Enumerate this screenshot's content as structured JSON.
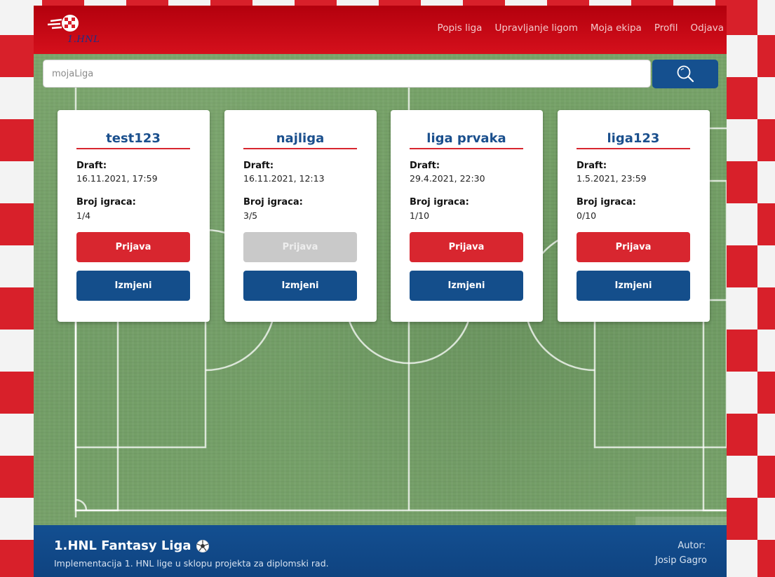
{
  "brand": {
    "logo_text": "1.HNL"
  },
  "nav": {
    "links": [
      "Popis liga",
      "Upravljanje ligom",
      "Moja ekipa",
      "Profil",
      "Odjava"
    ]
  },
  "search": {
    "placeholder": "mojaLiga",
    "value": ""
  },
  "leagues": [
    {
      "name": "test123",
      "draft_label": "Draft:",
      "draft": "16.11.2021, 17:59",
      "players_label": "Broj igraca:",
      "players": "1/4",
      "join_label": "Prijava",
      "join_enabled": true,
      "edit_label": "Izmjeni"
    },
    {
      "name": "najliga",
      "draft_label": "Draft:",
      "draft": "16.11.2021, 12:13",
      "players_label": "Broj igraca:",
      "players": "3/5",
      "join_label": "Prijava",
      "join_enabled": false,
      "edit_label": "Izmjeni"
    },
    {
      "name": "liga prvaka",
      "draft_label": "Draft:",
      "draft": "29.4.2021, 22:30",
      "players_label": "Broj igraca:",
      "players": "1/10",
      "join_label": "Prijava",
      "join_enabled": true,
      "edit_label": "Izmjeni"
    },
    {
      "name": "liga123",
      "draft_label": "Draft:",
      "draft": "1.5.2021, 23:59",
      "players_label": "Broj igraca:",
      "players": "0/10",
      "join_label": "Prijava",
      "join_enabled": true,
      "edit_label": "Izmjeni"
    }
  ],
  "footer": {
    "title": "1.HNL Fantasy Liga",
    "subtitle": "Implementacija 1. HNL lige u sklopu projekta za diplomski rad.",
    "author_label": "Autor:",
    "author": "Josip Gagro"
  },
  "colors": {
    "header_red": "#c80a16",
    "accent_blue": "#144e8b",
    "button_red": "#d8262f",
    "button_disabled": "#c9c9c9"
  },
  "icons": {
    "search": "magnifier-icon",
    "footer": "football-icon"
  }
}
